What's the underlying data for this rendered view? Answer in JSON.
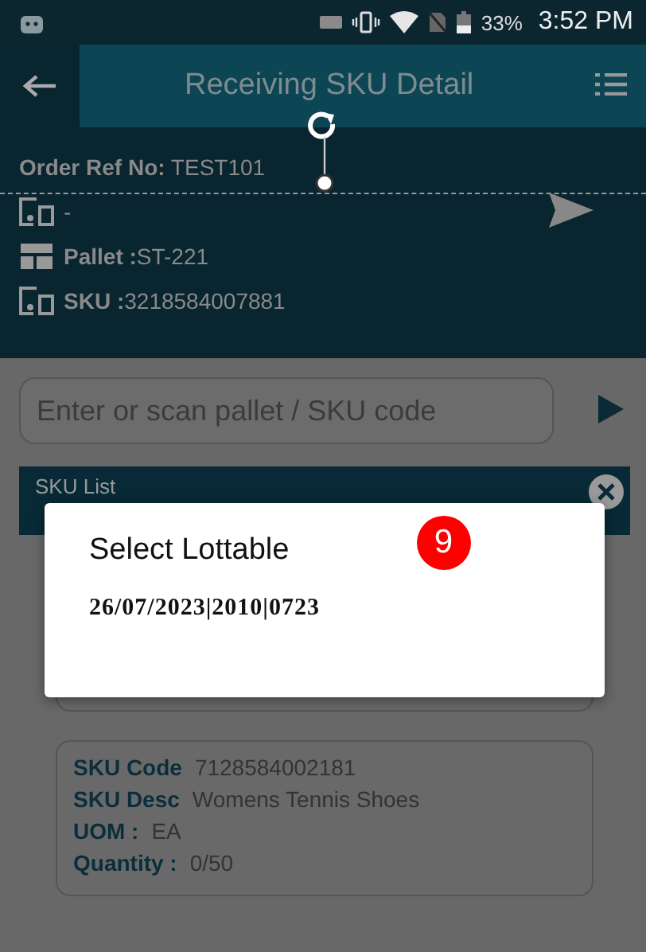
{
  "status_bar": {
    "battery": "33%",
    "time": "3:52 PM"
  },
  "header": {
    "title": "Receiving SKU Detail"
  },
  "order": {
    "ref_label": "Order Ref No:",
    "ref_value": "TEST101",
    "line_2": "-",
    "pallet_label": "Pallet :",
    "pallet_value": "ST-221",
    "sku_label": "SKU :",
    "sku_value": "3218584007881"
  },
  "scan_field": {
    "placeholder": "Enter or scan pallet / SKU code"
  },
  "sku_list": {
    "title": "SKU List",
    "cards": [
      {
        "fields": [
          {
            "label": "SKU Code",
            "value": "7128584002181"
          },
          {
            "label": "SKU Desc",
            "value": "Womens Tennis Shoes"
          },
          {
            "label": "UOM :",
            "value": "EA"
          },
          {
            "label": "Quantity :",
            "value": "0/50"
          }
        ]
      }
    ]
  },
  "dialog": {
    "title": "Select Lottable",
    "badge": "9",
    "options": [
      "26/07/2023|2010|0723"
    ]
  }
}
